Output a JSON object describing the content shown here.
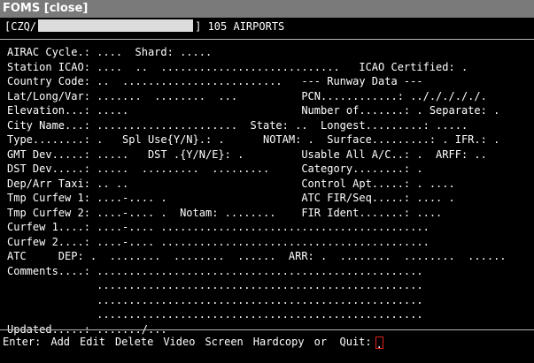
{
  "window": {
    "title": "FOMS [close]"
  },
  "header": {
    "prefix": "[CZQ/",
    "suffix": "] 105 AIRPORTS"
  },
  "screen_lines": [
    "AIRAC Cycle.: ....  Shard: .....",
    "Station ICAO: ....  ..  ............................   ICAO Certified: .",
    "Country Code: ..  .........................   --- Runway Data ---",
    "Lat/Long/Var: .......  ........  ...          PCN............: ../././././.",
    "Elevation...: .....                           Number of.......: . Separate: .",
    "City Name...: ......................  State: ..  Longest.........: .....",
    "Type........: .   Spl Use{Y/N}.: .      NOTAM: .  Surface.........: . IFR.: .",
    "GMT Dev.....: .....   DST .{Y/N/E}: .         Usable All A/C..: .  ARFF: ..",
    "DST Dev.....: .....  .........  .........     Category........: .",
    "Dep/Arr Taxi: .. ..                           Control Apt.....: . ....",
    "Tmp Curfew 1: ....-.... .                     ATC FIR/Seq.....: .... .",
    "Tmp Curfew 2: ....-.... .  Notam: ........    FIR Ident.......: ....",
    "Curfew 1....: ....-.... ..........................................",
    "Curfew 2....: ....-.... ..........................................",
    "ATC     DEP: .  ........  ........  ......  ARR: .  ........  ........  ......",
    "Comments....: ...................................................",
    "              ...................................................",
    "              ...................................................",
    "              ...................................................",
    "Updated.....: ......./..."
  ],
  "menu": {
    "prompt": "Enter:",
    "items": [
      "Add",
      "Edit",
      "Delete",
      "Video",
      "Screen",
      "Hardcopy"
    ],
    "quit_label": "or  Quit:",
    "cursor_value": "."
  }
}
